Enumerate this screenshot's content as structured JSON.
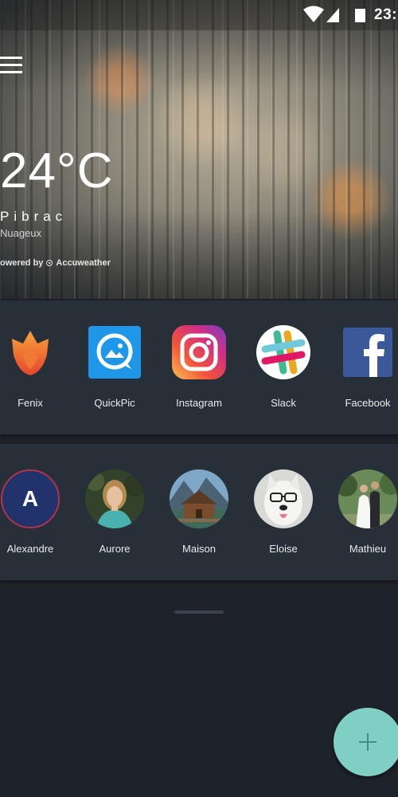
{
  "status_bar": {
    "time": "23:"
  },
  "weather": {
    "temperature": "24°C",
    "city": "Pibrac",
    "condition": "Nuageux",
    "powered_by": "owered by",
    "provider": "Accuweather"
  },
  "apps": [
    {
      "label": "Fenix",
      "icon": "fenix-icon"
    },
    {
      "label": "QuickPic",
      "icon": "quickpic-icon"
    },
    {
      "label": "Instagram",
      "icon": "instagram-icon"
    },
    {
      "label": "Slack",
      "icon": "slack-icon"
    },
    {
      "label": "Facebook",
      "icon": "facebook-icon"
    }
  ],
  "contacts": [
    {
      "label": "Alexandre",
      "initial": "A"
    },
    {
      "label": "Aurore"
    },
    {
      "label": "Maison"
    },
    {
      "label": "Eloise"
    },
    {
      "label": "Mathieu"
    }
  ],
  "colors": {
    "background": "#1e232a",
    "card": "#273038",
    "fab": "#7fcfc4"
  }
}
